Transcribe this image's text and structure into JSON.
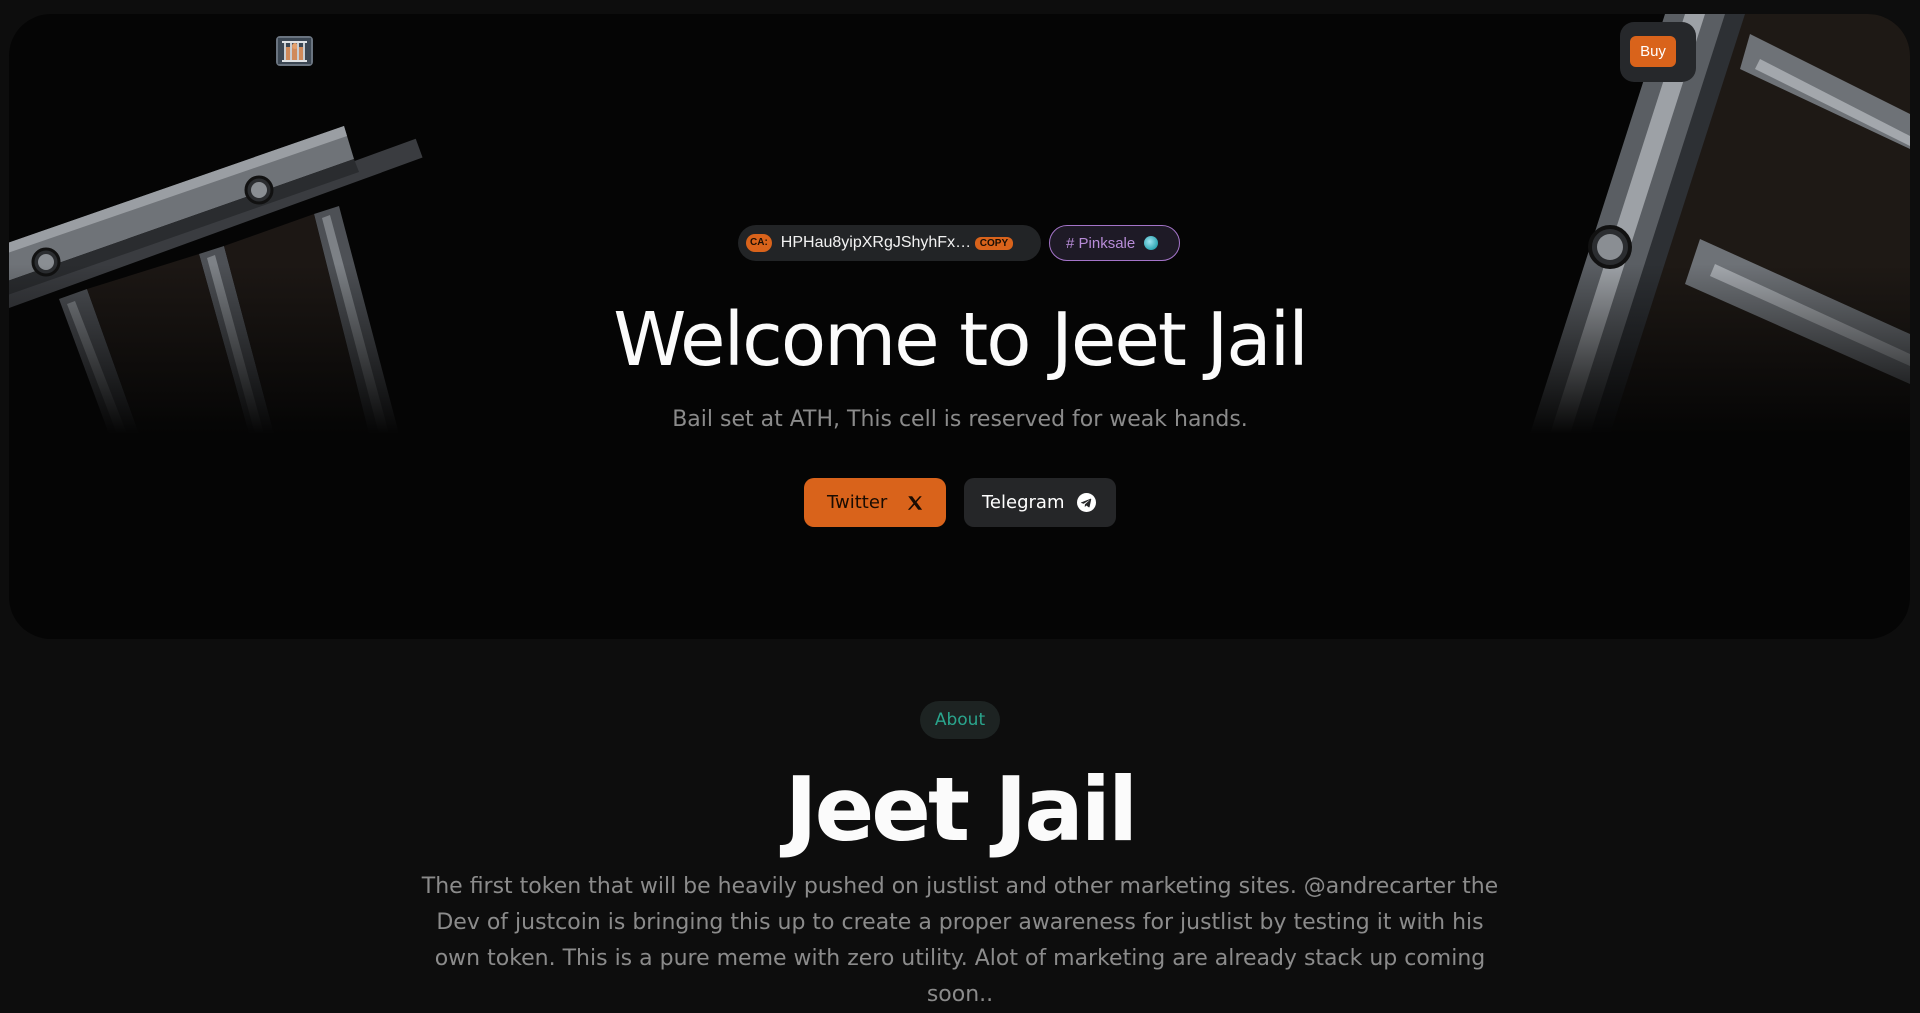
{
  "nav": {
    "logo_alt": "Jeet Jail jail-cell logo",
    "buy_label": "Buy"
  },
  "hero": {
    "ca_badge": "CA:",
    "contract_address": "HPHau8yipXRgJShyhFx…",
    "copy_label": "COPY",
    "pinksale_label": "# Pinksale",
    "title": "Welcome to Jeet Jail",
    "subtitle": "Bail set at ATH, This cell is reserved for weak hands.",
    "twitter_label": "Twitter",
    "telegram_label": "Telegram"
  },
  "about": {
    "badge": "About",
    "title": "Jeet Jail",
    "text": "The first token that will be heavily pushed on justlist and other marketing sites. @andrecarter the Dev of justcoin is bringing this up to create a proper awareness for justlist by testing it with his own token. This is a pure meme with zero utility. Alot of marketing are already stack up coming soon.."
  },
  "colors": {
    "accent": "#d9631b",
    "background": "#0d0d0d",
    "hero_background": "#050505",
    "pinksale": "#b88cd8",
    "about_teal": "#2aa58d"
  },
  "icons": [
    "jail-logo-icon",
    "x-icon",
    "telegram-icon",
    "globe-icon"
  ]
}
